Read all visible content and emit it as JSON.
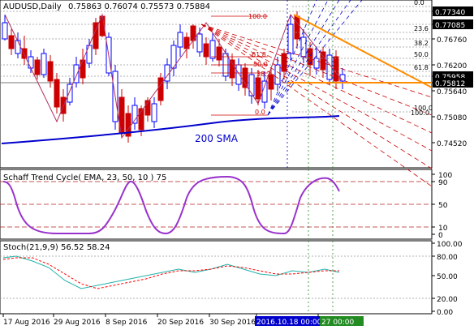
{
  "main": {
    "title": "AUDUSD,Daily",
    "ohlc": "0.75863 0.76074 0.75573 0.75884",
    "price_ticks": [
      "0.77340",
      "0.77085",
      "0.76760",
      "0.76200",
      "0.75958",
      "0.75812",
      "0.75640",
      "0.75080",
      "0.74520"
    ],
    "current_price": "0.75812",
    "bid_label": "0.75958",
    "sma_label": "200 SMA",
    "fib_labels": [
      "0.0",
      "23.6",
      "38.2",
      "50.0",
      "61.8",
      "100.0"
    ],
    "fan_labels": [
      "100.0",
      "61.8",
      "50.0",
      "38.2",
      "0.0",
      "100.0"
    ]
  },
  "stc": {
    "title": "Schaff Trend Cycle( EMA, 23, 50, 10 ) 75",
    "ticks": [
      "100",
      "90",
      "50",
      "10",
      "0"
    ]
  },
  "stoch": {
    "title": "Stoch(21,9,9) 56.52 58.24",
    "ticks": [
      "100.00",
      "80.00",
      "50.00",
      "20.00",
      "0.00"
    ]
  },
  "xaxis": {
    "dates": [
      "17 Aug 2016",
      "29 Aug 2016",
      "8 Sep 2016",
      "20 Sep 2016",
      "30 Sep 2016",
      "2016.10.18 00:00",
      "2016.10.27 00:00"
    ]
  },
  "colors": {
    "bull": "#0000ff",
    "bear": "#cc0000",
    "sma": "#0000cd",
    "trend": "#ff8c00",
    "stc": "#9932cc",
    "stoch_main": "#20b2aa",
    "stoch_signal": "#ff0000",
    "level": "#b22222"
  }
}
